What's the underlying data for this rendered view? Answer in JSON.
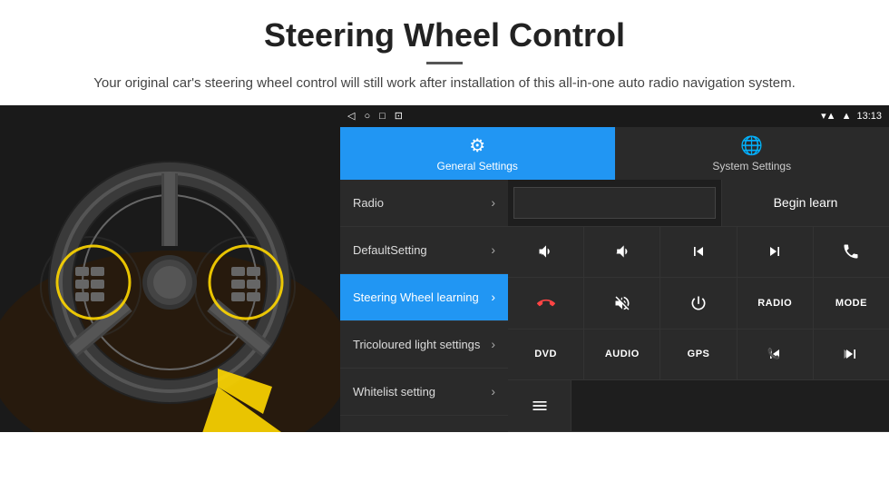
{
  "page": {
    "title": "Steering Wheel Control",
    "divider": "—",
    "subtitle": "Your original car's steering wheel control will still work after installation of this all-in-one auto radio navigation system."
  },
  "statusBar": {
    "back": "◁",
    "home": "○",
    "recent": "□",
    "cast": "⊡",
    "signal": "▾▲",
    "wifi": "▲",
    "time": "13:13"
  },
  "tabs": {
    "general": {
      "label": "General Settings",
      "icon": "⚙"
    },
    "system": {
      "label": "System Settings",
      "icon": "🌐"
    }
  },
  "menu": {
    "items": [
      {
        "label": "Radio",
        "active": false
      },
      {
        "label": "DefaultSetting",
        "active": false
      },
      {
        "label": "Steering Wheel learning",
        "active": true
      },
      {
        "label": "Tricoloured light settings",
        "active": false
      },
      {
        "label": "Whitelist setting",
        "active": false
      }
    ]
  },
  "controls": {
    "beginLearn": "Begin learn",
    "buttons": [
      [
        "vol_up",
        "vol_down",
        "prev_track",
        "next_track",
        "phone"
      ],
      [
        "hang_up",
        "mute",
        "power",
        "RADIO",
        "MODE"
      ],
      [
        "DVD",
        "AUDIO",
        "GPS",
        "prev_folder",
        "next_folder"
      ],
      [
        "menu_icon"
      ]
    ]
  }
}
